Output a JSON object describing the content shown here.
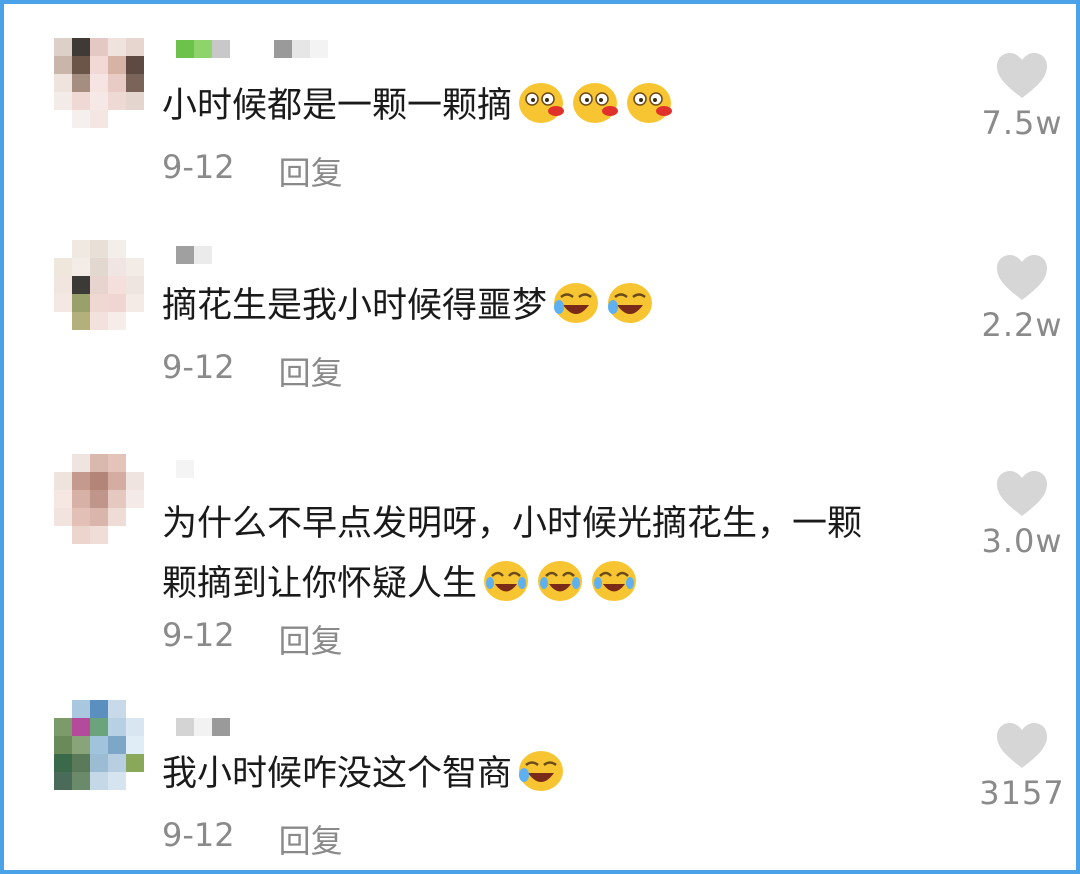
{
  "comments": [
    {
      "text": "小时候都是一颗一颗摘",
      "emojis": [
        "drooling-face-icon",
        "drooling-face-icon",
        "drooling-face-icon"
      ],
      "date": "9-12",
      "reply_label": "回复",
      "likes": "7.5w"
    },
    {
      "text": "摘花生是我小时候得噩梦",
      "emojis": [
        "rofl-face-icon",
        "rofl-face-icon"
      ],
      "date": "9-12",
      "reply_label": "回复",
      "likes": "2.2w"
    },
    {
      "text": "为什么不早点发明呀，小时候光摘花生，一颗\n颗摘到让你怀疑人生",
      "emojis": [
        "crying-laughing-face-icon",
        "crying-laughing-face-icon",
        "crying-laughing-face-icon"
      ],
      "date": "9-12",
      "reply_label": "回复",
      "likes": "3.0w"
    },
    {
      "text": "我小时候咋没这个智商",
      "emojis": [
        "rofl-face-icon"
      ],
      "date": "9-12",
      "reply_label": "回复",
      "likes": "3157"
    }
  ],
  "colors": {
    "border": "#4aa3e8",
    "text": "#1a1a1a",
    "meta": "#8a8a8a",
    "heart": "#d6d6d6"
  }
}
